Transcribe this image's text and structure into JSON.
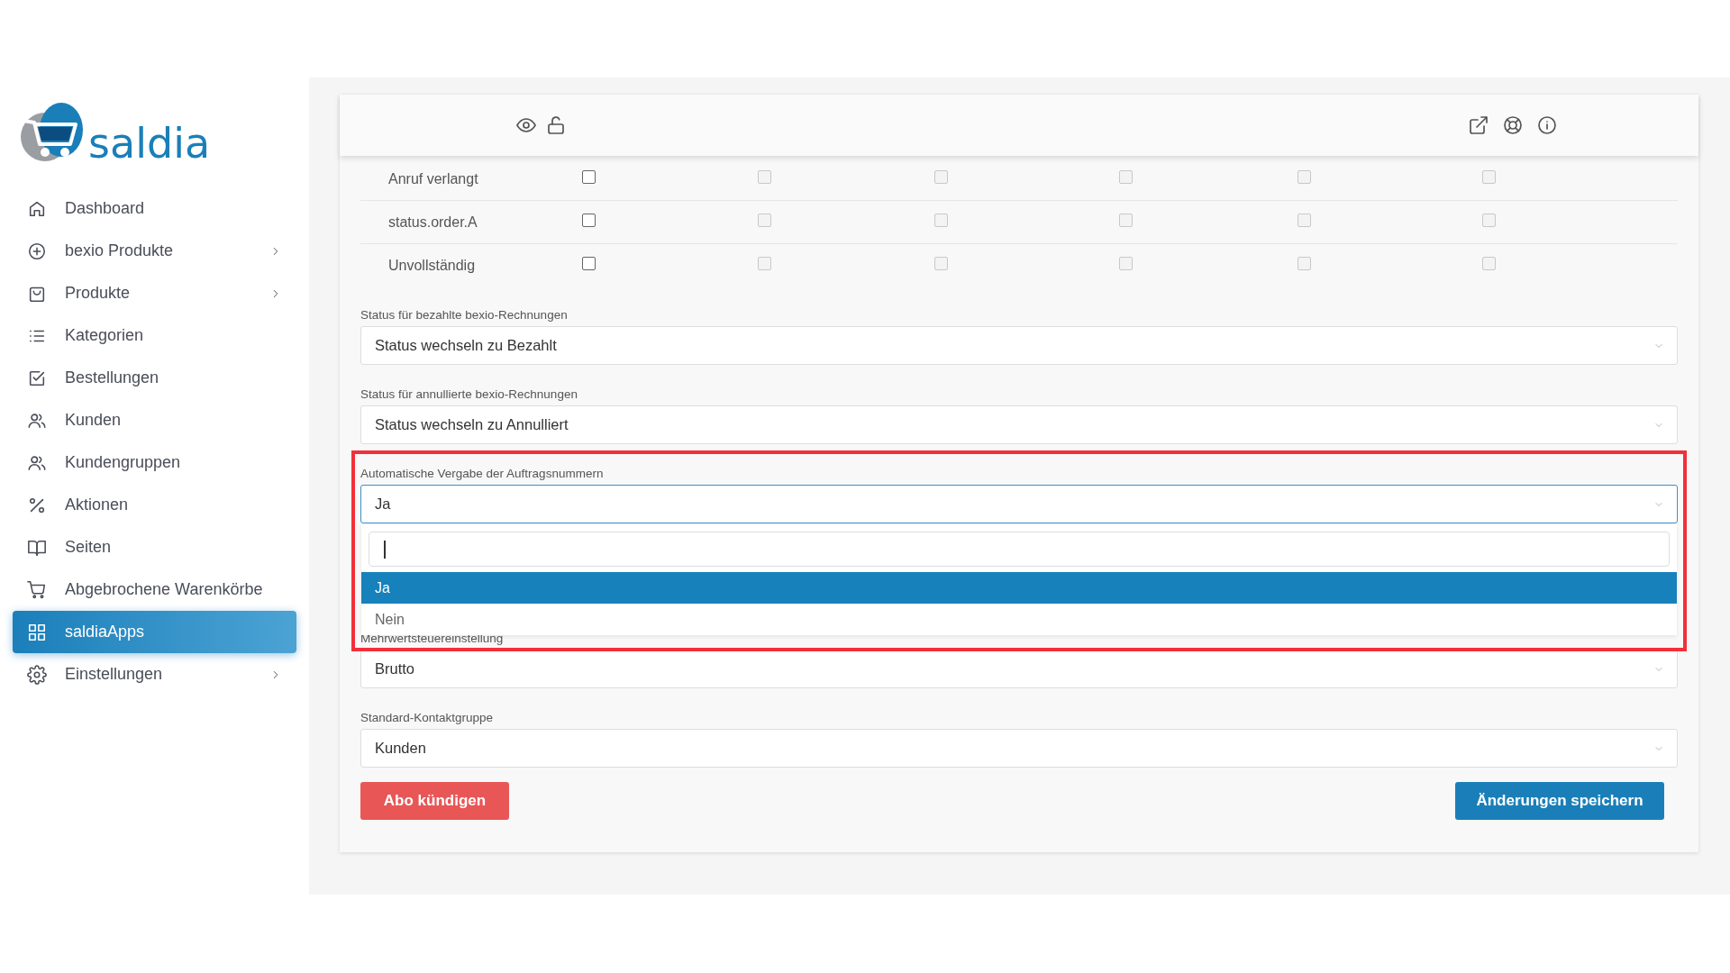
{
  "logo": {
    "text": "saldia"
  },
  "sidebar": {
    "items": [
      {
        "label": "Dashboard",
        "expandable": false,
        "selected": false
      },
      {
        "label": "bexio Produkte",
        "expandable": true,
        "selected": false
      },
      {
        "label": "Produkte",
        "expandable": true,
        "selected": false
      },
      {
        "label": "Kategorien",
        "expandable": false,
        "selected": false
      },
      {
        "label": "Bestellungen",
        "expandable": false,
        "selected": false
      },
      {
        "label": "Kunden",
        "expandable": false,
        "selected": false
      },
      {
        "label": "Kundengruppen",
        "expandable": false,
        "selected": false
      },
      {
        "label": "Aktionen",
        "expandable": false,
        "selected": false
      },
      {
        "label": "Seiten",
        "expandable": false,
        "selected": false
      },
      {
        "label": "Abgebrochene Warenkörbe",
        "expandable": false,
        "selected": false
      },
      {
        "label": "saldiaApps",
        "expandable": false,
        "selected": true
      },
      {
        "label": "Einstellungen",
        "expandable": true,
        "selected": false
      }
    ]
  },
  "status_table": {
    "rows": [
      {
        "label": "Anruf verlangt",
        "checkboxes": [
          {
            "checked": false,
            "disabled": false
          },
          {
            "checked": false,
            "disabled": true
          },
          {
            "checked": false,
            "disabled": true
          },
          {
            "checked": false,
            "disabled": true
          },
          {
            "checked": false,
            "disabled": true
          },
          {
            "checked": false,
            "disabled": true
          }
        ]
      },
      {
        "label": "status.order.A",
        "checkboxes": [
          {
            "checked": false,
            "disabled": false
          },
          {
            "checked": false,
            "disabled": true
          },
          {
            "checked": false,
            "disabled": true
          },
          {
            "checked": false,
            "disabled": true
          },
          {
            "checked": false,
            "disabled": true
          },
          {
            "checked": false,
            "disabled": true
          }
        ]
      },
      {
        "label": "Unvollständig",
        "checkboxes": [
          {
            "checked": false,
            "disabled": false
          },
          {
            "checked": false,
            "disabled": true
          },
          {
            "checked": false,
            "disabled": true
          },
          {
            "checked": false,
            "disabled": true
          },
          {
            "checked": false,
            "disabled": true
          },
          {
            "checked": false,
            "disabled": true
          }
        ]
      }
    ]
  },
  "fields": [
    {
      "label": "Status für bezahlte bexio-Rechnungen",
      "value": "Status wechseln zu Bezahlt",
      "expanded": false
    },
    {
      "label": "Status für annullierte bexio-Rechnungen",
      "value": "Status wechseln zu Annulliert",
      "expanded": false
    },
    {
      "label": "Automatische Vergabe der Auftragsnummern",
      "value": "Ja",
      "expanded": true,
      "highlighted": true,
      "options": [
        {
          "label": "Ja",
          "selected": true
        },
        {
          "label": "Nein",
          "selected": false
        }
      ]
    },
    {
      "label": "Mehrwertsteuereinstellung",
      "value": "Brutto",
      "expanded": false
    },
    {
      "label": "Standard-Kontaktgruppe",
      "value": "Kunden",
      "expanded": false
    }
  ],
  "buttons": {
    "cancel": "Abo kündigen",
    "save": "Änderungen speichern"
  }
}
